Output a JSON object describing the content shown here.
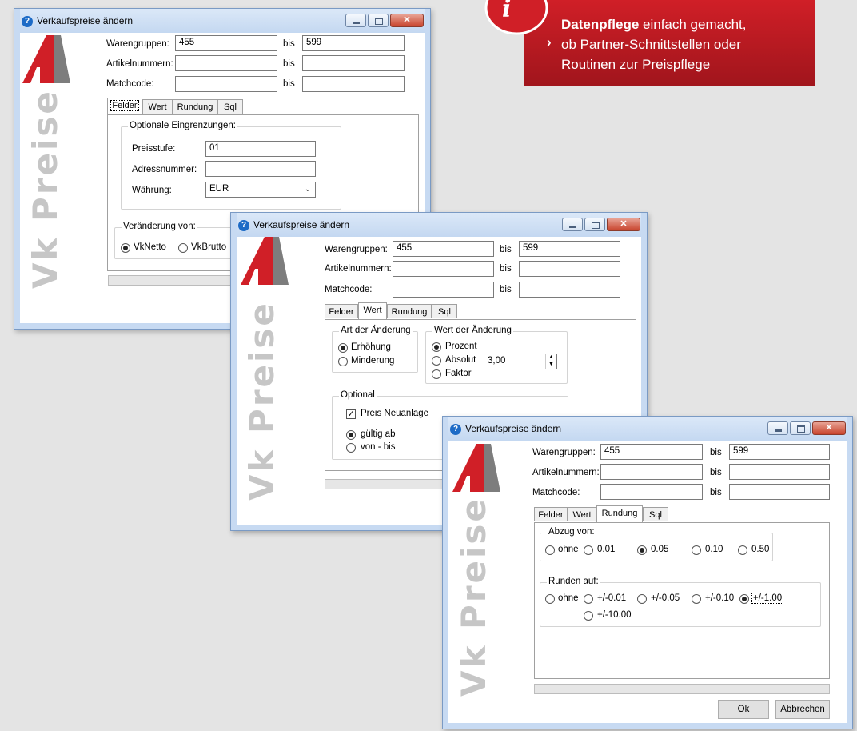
{
  "callout": {
    "bold": "Datenpflege",
    "line1_rest": " einfach gemacht,",
    "line2": "ob Partner-Schnittstellen oder",
    "line3": "Routinen zur Preispflege",
    "icon": "info-icon"
  },
  "dialog_title": "Verkaufspreise ändern",
  "watermark": "Vk Preise",
  "labels": {
    "warengruppen": "Warengruppen:",
    "artikelnummern": "Artikelnummern:",
    "matchcode": "Matchcode:",
    "bis": "bis"
  },
  "values": {
    "warengruppe_from": "455",
    "warengruppe_to": "599",
    "artikel_from": "",
    "artikel_to": "",
    "matchcode_from": "",
    "matchcode_to": ""
  },
  "tabs": [
    "Felder",
    "Wert",
    "Rundung",
    "Sql"
  ],
  "felder": {
    "optional_title": "Optionale Eingrenzungen:",
    "preisstufe_label": "Preisstufe:",
    "preisstufe_value": "01",
    "adressnummer_label": "Adressnummer:",
    "adressnummer_value": "",
    "waehrung_label": "Währung:",
    "waehrung_value": "EUR",
    "veraenderung_title": "Veränderung von:",
    "vknetto": "VkNetto",
    "vkbrutto": "VkBrutto"
  },
  "wert": {
    "art_title": "Art der Änderung",
    "erhoehung": "Erhöhung",
    "minderung": "Minderung",
    "wert_title": "Wert der Änderung",
    "prozent": "Prozent",
    "absolut": "Absolut",
    "faktor": "Faktor",
    "wert_value": "3,00",
    "optional_title": "Optional",
    "preis_neuanlage": "Preis Neuanlage",
    "gueltig_ab": "gültig ab",
    "von_bis": "von - bis"
  },
  "rundung": {
    "abzug_title": "Abzug von:",
    "abzug_options": [
      "ohne",
      "0.01",
      "0.05",
      "0.10",
      "0.50"
    ],
    "abzug_selected": "0.05",
    "runden_title": "Runden auf:",
    "runden_options": [
      "ohne",
      "+/-0.01",
      "+/-0.05",
      "+/-0.10",
      "+/-1.00",
      "+/-10.00"
    ],
    "runden_selected": "+/-1.00"
  },
  "buttons": {
    "ok": "Ok",
    "abbrechen": "Abbrechen"
  },
  "colors": {
    "brand_red": "#d01f27",
    "watermark_gray": "#c6c6c6",
    "frame_blue": "#c7daf2"
  }
}
